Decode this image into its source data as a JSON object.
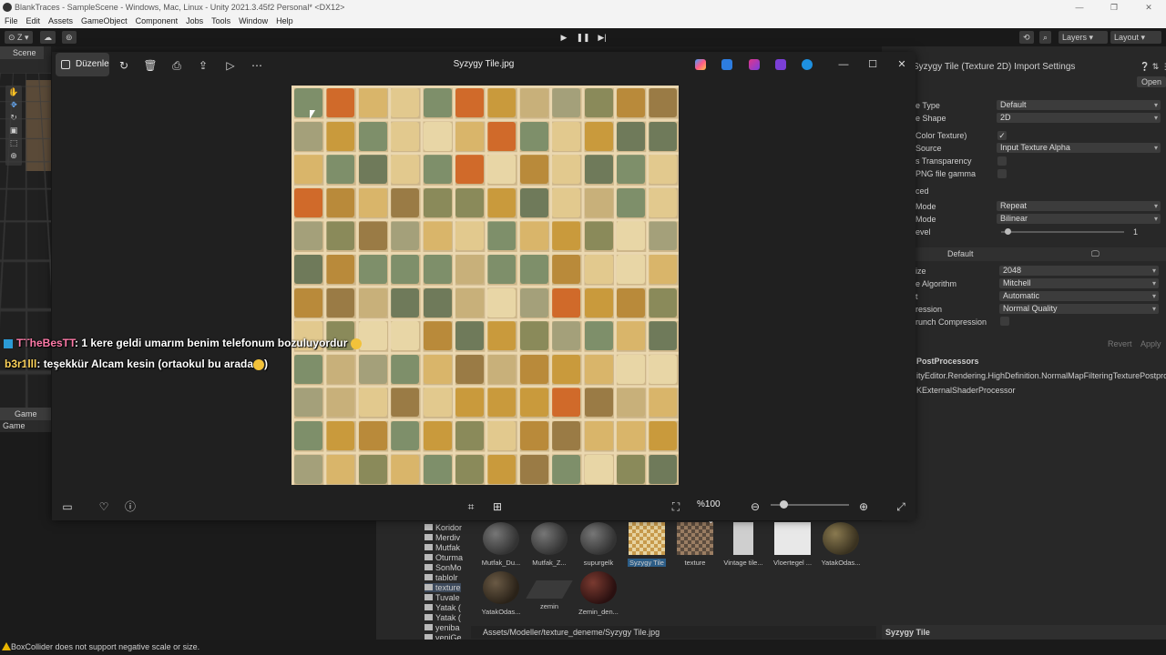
{
  "unity": {
    "title": "BlankTraces - SampleScene - Windows, Mac, Linux - Unity 2021.3.45f2 Personal* <DX12>",
    "menu": [
      "File",
      "Edit",
      "Assets",
      "GameObject",
      "Component",
      "Jobs",
      "Tools",
      "Window",
      "Help"
    ],
    "toolbar": {
      "account": "Z",
      "layers": "Layers",
      "layout": "Layout"
    },
    "scene_tab": "Scene",
    "game_tab": "Game",
    "game_dropdown": "Game",
    "status_message": "BoxCollider does not support negative scale or size.",
    "inspector": {
      "title": "Syzygy Tile (Texture 2D) Import Settings",
      "open_label": "Open",
      "rows": [
        {
          "label": "e Type",
          "value": "Default"
        },
        {
          "label": "e Shape",
          "value": "2D"
        },
        {
          "label": "Color Texture)",
          "value": "✓"
        },
        {
          "label": "Source",
          "value": "Input Texture Alpha"
        },
        {
          "label": "s Transparency",
          "value": ""
        },
        {
          "label": "PNG file gamma",
          "value": ""
        },
        {
          "label": "ced",
          "value": ""
        },
        {
          "label": "Mode",
          "value": "Repeat"
        },
        {
          "label": "Mode",
          "value": "Bilinear"
        },
        {
          "label": "evel",
          "value": "1"
        }
      ],
      "platform_tab": "Default",
      "platform_rows": [
        {
          "label": "ize",
          "value": "2048"
        },
        {
          "label": "e Algorithm",
          "value": "Mitchell"
        },
        {
          "label": "t",
          "value": "Automatic"
        },
        {
          "label": "ression",
          "value": "Normal Quality"
        },
        {
          "label": "runch Compression",
          "value": ""
        }
      ],
      "revert_label": "Revert",
      "apply_label": "Apply",
      "postprocessors_title": "PostProcessors",
      "postprocessors": [
        "ityEditor.Rendering.HighDefinition.NormalMapFilteringTexturePostprocess",
        "KExternalShaderProcessor"
      ],
      "asset_label": "Syzygy Tile"
    },
    "project": {
      "folders": [
        "Koridor",
        "Merdiv",
        "Mutfak",
        "Oturma",
        "SonMo",
        "tablolr",
        "texture",
        "Tuvale",
        "Yatak (",
        "Yatak (",
        "yeniba",
        "yeniGe"
      ],
      "assets": [
        "Mutfak_Du...",
        "Mutfak_Z...",
        "supurgelk",
        "Syzygy Tile",
        "texture",
        "Vintage tile...",
        "Vloertegel ...",
        "YatakOdas...",
        "YatakOdas...",
        "zemin",
        "Zemin_den..."
      ],
      "path": "Assets/Modeller/texture_deneme/Syzygy Tile.jpg"
    }
  },
  "photos": {
    "edit_label": "Düzenle",
    "file_title": "Syzygy Tile.jpg",
    "zoom": "%100",
    "zoom_level": 0.12,
    "icons": [
      "rotate-icon",
      "delete-icon",
      "print-icon",
      "share-icon",
      "slideshow-icon",
      "more-icon"
    ]
  },
  "chat": [
    {
      "user": "TTheBesTT",
      "message": ": 1 kere geldi umarım benim telefonum bozuluyordur"
    },
    {
      "user": "b3r1lll",
      "message": ": teşekkür Alcam kesin (ortaokul bu arada"
    }
  ]
}
